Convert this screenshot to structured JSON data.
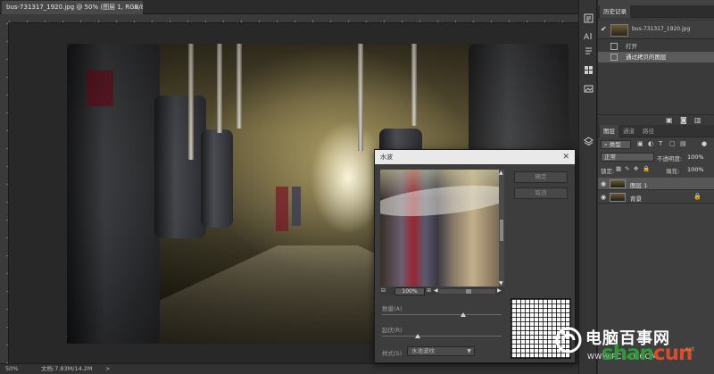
{
  "document": {
    "tab_title": "bus-731317_1920.jpg @ 50% (图层 1, RGB/8#) *",
    "close_glyph": "×"
  },
  "statusbar": {
    "zoom": "50%",
    "doc_info": "文档:7.83M/14.2M",
    "arrow": ">"
  },
  "history_panel": {
    "tab": "历史记录",
    "snapshot_name": "bus-731317_1920.jpg",
    "items": [
      {
        "label": "打开"
      },
      {
        "label": "通过拷贝的图层"
      }
    ]
  },
  "layers_panel": {
    "tabs": [
      "图层",
      "通道",
      "路径"
    ],
    "filter_kind": "类型",
    "blend_mode": "正常",
    "opacity_label": "不透明度:",
    "opacity_value": "100%",
    "lock_label": "锁定:",
    "fill_label": "填充:",
    "fill_value": "100%",
    "layers": [
      {
        "name": "图层 1",
        "selected": true
      },
      {
        "name": "背景",
        "selected": false
      }
    ]
  },
  "dialog": {
    "title": "水波",
    "ok_label": "确定",
    "cancel_label": "取消",
    "zoom_value": "100%",
    "zoom_out": "⊟",
    "zoom_in": "⊞",
    "params": [
      {
        "label": "数量(A)",
        "value": "",
        "knob": 0.68
      },
      {
        "label": "起伏(R)",
        "value": "",
        "knob": 0.3
      }
    ],
    "mode_label": "样式(S)",
    "mode_value": "水池波纹"
  },
  "watermark": {
    "brand_cn": "电脑百事网",
    "url": "WWW.PC841.COM",
    "domain_a": "shan",
    "domain_b": "cun",
    "domain_suffix": ".net"
  },
  "colors": {
    "app_bg": "#282828",
    "panel_bg": "#424242",
    "selected_row": "#575757",
    "dialog_title_bg": "#e9e9e9"
  }
}
